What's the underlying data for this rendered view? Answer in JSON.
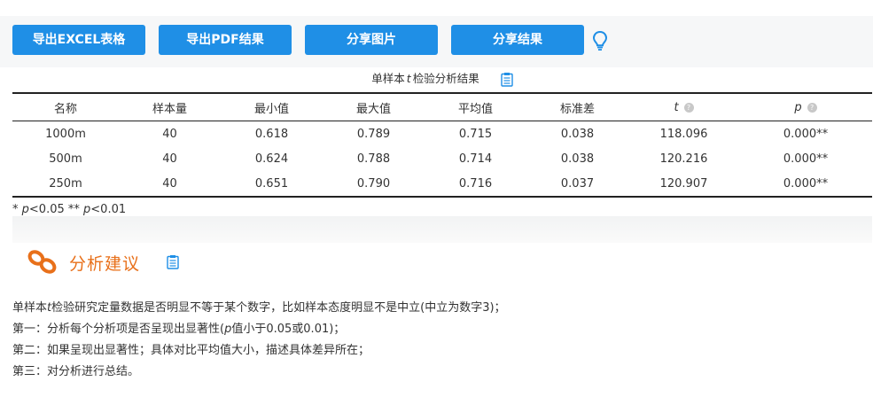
{
  "toolbar": {
    "buttons": [
      "导出EXCEL表格",
      "导出PDF结果",
      "分享图片",
      "分享结果"
    ]
  },
  "table": {
    "title_prefix": "单样本",
    "title_t": "t",
    "title_suffix": "检验分析结果",
    "headers": [
      "名称",
      "样本量",
      "最小值",
      "最大值",
      "平均值",
      "标准差",
      "t",
      "p"
    ],
    "rows": [
      [
        "1000m",
        "40",
        "0.618",
        "0.789",
        "0.715",
        "0.038",
        "118.096",
        "0.000**"
      ],
      [
        "500m",
        "40",
        "0.624",
        "0.788",
        "0.714",
        "0.038",
        "120.216",
        "0.000**"
      ],
      [
        "250m",
        "40",
        "0.651",
        "0.790",
        "0.716",
        "0.037",
        "120.907",
        "0.000**"
      ]
    ],
    "note_a": "* ",
    "note_p1": "p",
    "note_b": "<0.05 ** ",
    "note_p2": "p",
    "note_c": "<0.01"
  },
  "advice": {
    "title": "分析建议",
    "line1_a": "单样本",
    "line1_t": "t",
    "line1_b": "检验研究定量数据是否明显不等于某个数字，比如样本态度明显不是中立(中立为数字3)；",
    "line2_a": "第一：分析每个分析项是否呈现出显著性(",
    "line2_p": "p",
    "line2_b": "值小于0.05或0.01)；",
    "line3": "第二：如果呈现出显著性；具体对比平均值大小，描述具体差异所在；",
    "line4": "第三：对分析进行总结。"
  },
  "colors": {
    "button": "#1f8fe6",
    "accent": "#e8701a",
    "icon": "#1f8fe6"
  },
  "icons": [
    "lightbulb-icon",
    "document-icon",
    "chain-link-icon",
    "help-circle-icon"
  ]
}
